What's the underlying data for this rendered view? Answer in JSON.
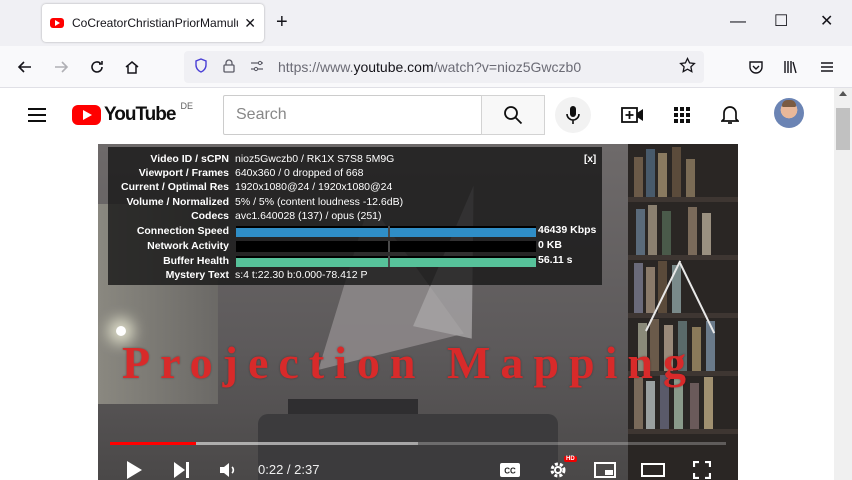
{
  "browser": {
    "tab_title": "CoCreatorChristianPriorMamulu",
    "tab_close": "✕",
    "new_tab": "+",
    "window_controls": {
      "minimize": "—",
      "maximize": "☐",
      "close": "✕"
    },
    "url_prefix": "https://www.",
    "url_domain": "youtube.com",
    "url_path": "/watch?v=nioz5Gwczb0"
  },
  "youtube": {
    "logo_text": "YouTube",
    "country_code": "DE",
    "search_placeholder": "Search"
  },
  "stats": {
    "close_label": "[x]",
    "rows": [
      {
        "key": "Video ID / sCPN",
        "value": "nioz5Gwczb0 / RK1X S7S8 5M9G"
      },
      {
        "key": "Viewport / Frames",
        "value": "640x360 / 0 dropped of 668"
      },
      {
        "key": "Current / Optimal Res",
        "value": "1920x1080@24 / 1920x1080@24"
      },
      {
        "key": "Volume / Normalized",
        "value": "5% / 5% (content loudness -12.6dB)"
      },
      {
        "key": "Codecs",
        "value": "avc1.640028 (137) / opus (251)"
      }
    ],
    "graphs": [
      {
        "key": "Connection Speed",
        "value": "46439 Kbps",
        "fill": 1.0,
        "color": "#2f8ec7"
      },
      {
        "key": "Network Activity",
        "value": "0 KB",
        "fill": 0.0,
        "color": "#2f8ec7"
      },
      {
        "key": "Buffer Health",
        "value": "56.11 s",
        "fill": 1.0,
        "color": "#57c29a"
      }
    ],
    "mystery": {
      "key": "Mystery Text",
      "value": "s:4 t:22.30 b:0.000-78.412 P"
    }
  },
  "video": {
    "overlay_text": "Projection Mapping",
    "current_time": "0:22",
    "duration": "2:37",
    "time_display": "0:22 / 2:37",
    "played_fraction": 0.14,
    "loaded_fraction": 0.5,
    "hd_badge": "HD"
  }
}
